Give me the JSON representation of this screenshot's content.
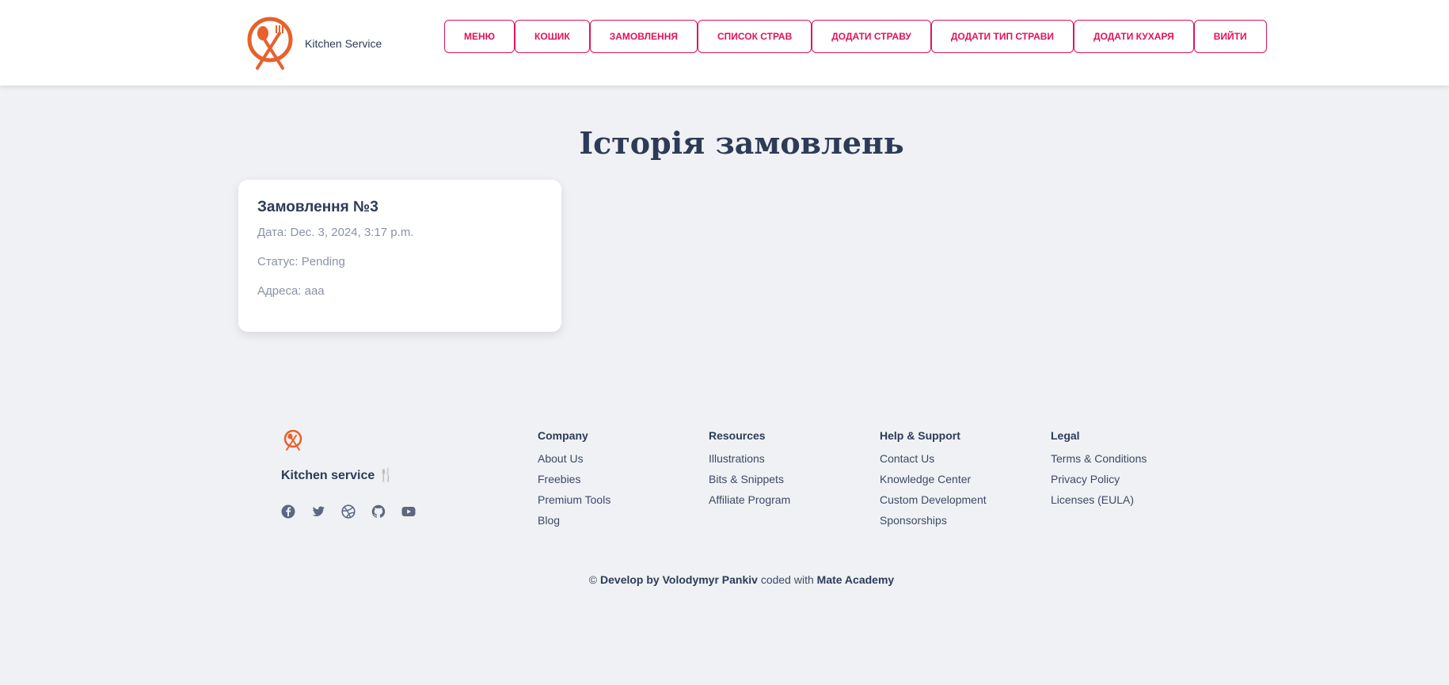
{
  "header": {
    "brand_name": "Kitchen Service",
    "nav": [
      {
        "label": "МЕНЮ"
      },
      {
        "label": "КОШИК"
      },
      {
        "label": "ЗАМОВЛЕННЯ"
      },
      {
        "label": "СПИСОК СТРАВ"
      },
      {
        "label": "ДОДАТИ СТРАВУ"
      },
      {
        "label": "ДОДАТИ ТИП СТРАВИ"
      },
      {
        "label": "ДОДАТИ КУХАРЯ"
      },
      {
        "label": "ВИЙТИ"
      }
    ]
  },
  "main": {
    "title": "Історія замовлень",
    "orders": [
      {
        "title": "Замовлення №3",
        "date": "Дата: Dec. 3, 2024, 3:17 p.m.",
        "status": "Статус: Pending",
        "address": "Адреса: aaa"
      }
    ]
  },
  "footer": {
    "brand": "Kitchen service 🍴",
    "social_icons": [
      "facebook-icon",
      "twitter-icon",
      "dribbble-icon",
      "github-icon",
      "youtube-icon"
    ],
    "columns": [
      {
        "heading": "Company",
        "links": [
          "About Us",
          "Freebies",
          "Premium Tools",
          "Blog"
        ]
      },
      {
        "heading": "Resources",
        "links": [
          "Illustrations",
          "Bits & Snippets",
          "Affiliate Program"
        ]
      },
      {
        "heading": "Help & Support",
        "links": [
          "Contact Us",
          "Knowledge Center",
          "Custom Development",
          "Sponsorships"
        ]
      },
      {
        "heading": "Legal",
        "links": [
          "Terms & Conditions",
          "Privacy Policy",
          "Licenses (EULA)"
        ]
      }
    ],
    "copyright": {
      "prefix": "© ",
      "author": "Develop by Volodymyr Pankiv",
      "middle": " coded with ",
      "org": "Mate Academy"
    }
  },
  "colors": {
    "accent": "#e0135d",
    "logo_orange": "#e8602c",
    "text_dark": "#2d3b57",
    "background": "#eff1f5"
  }
}
